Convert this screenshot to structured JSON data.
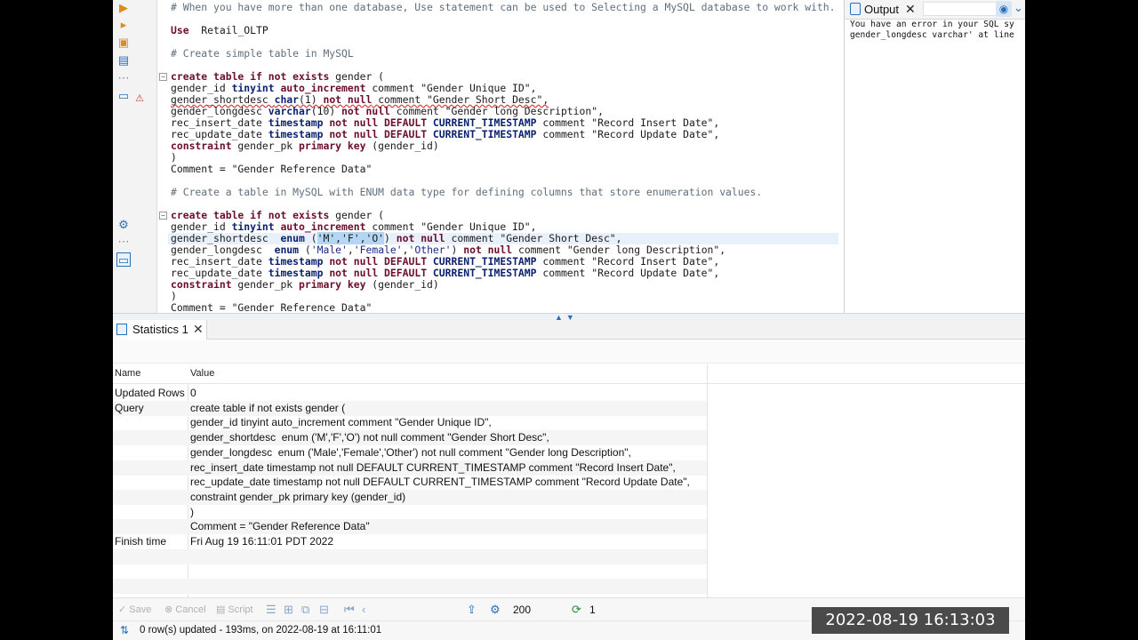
{
  "editor": {
    "lines": [
      {
        "id": "l0",
        "type": "comment",
        "text": "# When you have more than one database, Use statement can be used to Selecting a MySQL database to work with."
      },
      {
        "id": "l1",
        "type": "code",
        "parts": [
          [
            "kw",
            "Use"
          ],
          [
            "",
            "  Retail_OLTP"
          ]
        ]
      },
      {
        "id": "l2",
        "type": "comment",
        "text": "# Create simple table in MySQL"
      },
      {
        "id": "l3",
        "type": "code",
        "parts": [
          [
            "kw",
            "create table if not exists"
          ],
          [
            "",
            " gender ("
          ]
        ]
      },
      {
        "id": "l4",
        "type": "code",
        "parts": [
          [
            "",
            "gender_id "
          ],
          [
            "kw2",
            "tinyint"
          ],
          [
            "",
            " "
          ],
          [
            "kw",
            "auto_increment"
          ],
          [
            "",
            " comment \"Gender Unique ID\","
          ]
        ]
      },
      {
        "id": "l5",
        "type": "code",
        "err": true,
        "parts": [
          [
            "",
            "gender_shortdesc "
          ],
          [
            "kw2",
            "char"
          ],
          [
            "",
            "(1) "
          ],
          [
            "kw",
            "not null"
          ],
          [
            "",
            " comment \"Gender Short Desc\","
          ]
        ]
      },
      {
        "id": "l6",
        "type": "code",
        "parts": [
          [
            "",
            "gender_longdesc "
          ],
          [
            "kw2",
            "varchar"
          ],
          [
            "",
            "(10) "
          ],
          [
            "kw",
            "not null"
          ],
          [
            "",
            " comment \"Gender long Description\","
          ]
        ]
      },
      {
        "id": "l7",
        "type": "code",
        "parts": [
          [
            "",
            "rec_insert_date "
          ],
          [
            "kw2",
            "timestamp"
          ],
          [
            "",
            " "
          ],
          [
            "kw",
            "not null DEFAULT"
          ],
          [
            "",
            " "
          ],
          [
            "kw2",
            "CURRENT_TIMESTAMP"
          ],
          [
            "",
            " comment \"Record Insert Date\","
          ]
        ]
      },
      {
        "id": "l8",
        "type": "code",
        "parts": [
          [
            "",
            "rec_update_date "
          ],
          [
            "kw2",
            "timestamp"
          ],
          [
            "",
            " "
          ],
          [
            "kw",
            "not null DEFAULT"
          ],
          [
            "",
            " "
          ],
          [
            "kw2",
            "CURRENT_TIMESTAMP"
          ],
          [
            "",
            " comment \"Record Update Date\","
          ]
        ]
      },
      {
        "id": "l9",
        "type": "code",
        "parts": [
          [
            "kw",
            "constraint"
          ],
          [
            "",
            " gender_pk "
          ],
          [
            "kw",
            "primary key"
          ],
          [
            "",
            " (gender_id)"
          ]
        ]
      },
      {
        "id": "l10",
        "type": "code",
        "parts": [
          [
            "",
            ")"
          ]
        ]
      },
      {
        "id": "l11",
        "type": "code",
        "parts": [
          [
            "",
            "Comment = \"Gender Reference Data\""
          ]
        ]
      },
      {
        "id": "l12",
        "type": "comment",
        "text": "# Create a table in MySQL with ENUM data type for defining columns that store enumeration values."
      },
      {
        "id": "l13",
        "type": "code",
        "parts": [
          [
            "kw",
            "create table if not exists"
          ],
          [
            "",
            " gender ("
          ]
        ]
      },
      {
        "id": "l14",
        "type": "code",
        "parts": [
          [
            "",
            "gender_id "
          ],
          [
            "kw2",
            "tinyint"
          ],
          [
            "",
            " "
          ],
          [
            "kw",
            "auto_increment"
          ],
          [
            "",
            " comment \"Gender Unique ID\","
          ]
        ]
      },
      {
        "id": "l15",
        "type": "code",
        "hl": true,
        "parts": [
          [
            "",
            "gender_shortdesc  "
          ],
          [
            "kw2",
            "enum"
          ],
          [
            "",
            " ("
          ],
          [
            "sel",
            "'M','F','O'"
          ],
          [
            "",
            ") "
          ],
          [
            "kw",
            "not null"
          ],
          [
            "",
            " comment \"Gender Short Desc\","
          ]
        ]
      },
      {
        "id": "l16",
        "type": "code",
        "parts": [
          [
            "",
            "gender_longdesc  "
          ],
          [
            "kw2",
            "enum"
          ],
          [
            "",
            " ("
          ],
          [
            "str",
            "'Male'"
          ],
          [
            "",
            ","
          ],
          [
            "str",
            "'Female'"
          ],
          [
            "",
            ","
          ],
          [
            "str",
            "'Other'"
          ],
          [
            "",
            ") "
          ],
          [
            "kw",
            "not null"
          ],
          [
            "",
            " comment \"Gender long Description\","
          ]
        ]
      },
      {
        "id": "l17",
        "type": "code",
        "parts": [
          [
            "",
            "rec_insert_date "
          ],
          [
            "kw2",
            "timestamp"
          ],
          [
            "",
            " "
          ],
          [
            "kw",
            "not null DEFAULT"
          ],
          [
            "",
            " "
          ],
          [
            "kw2",
            "CURRENT_TIMESTAMP"
          ],
          [
            "",
            " comment \"Record Insert Date\","
          ]
        ]
      },
      {
        "id": "l18",
        "type": "code",
        "parts": [
          [
            "",
            "rec_update_date "
          ],
          [
            "kw2",
            "timestamp"
          ],
          [
            "",
            " "
          ],
          [
            "kw",
            "not null DEFAULT"
          ],
          [
            "",
            " "
          ],
          [
            "kw2",
            "CURRENT_TIMESTAMP"
          ],
          [
            "",
            " comment \"Record Update Date\","
          ]
        ]
      },
      {
        "id": "l19",
        "type": "code",
        "parts": [
          [
            "kw",
            "constraint"
          ],
          [
            "",
            " gender_pk "
          ],
          [
            "kw",
            "primary key"
          ],
          [
            "",
            " (gender_id)"
          ]
        ]
      },
      {
        "id": "l20",
        "type": "code",
        "parts": [
          [
            "",
            ")"
          ]
        ]
      },
      {
        "id": "l21",
        "type": "code",
        "parts": [
          [
            "",
            "Comment = \"Gender Reference Data\""
          ]
        ]
      }
    ]
  },
  "output_panel": {
    "tab_label": "Output",
    "lines": [
      "You have an error in your SQL sy",
      "gender_longdesc varchar' at line"
    ]
  },
  "results": {
    "tab_label": "Statistics 1",
    "columns": {
      "name": "Name",
      "value": "Value"
    },
    "rows": [
      {
        "name": "Updated Rows",
        "value": "0"
      },
      {
        "name": "Query",
        "value": "create table if not exists gender ("
      },
      {
        "name": "",
        "value": "gender_id tinyint auto_increment comment \"Gender Unique ID\","
      },
      {
        "name": "",
        "value": "gender_shortdesc  enum ('M','F','O') not null comment \"Gender Short Desc\","
      },
      {
        "name": "",
        "value": "gender_longdesc  enum ('Male','Female','Other') not null comment \"Gender long Description\","
      },
      {
        "name": "",
        "value": "rec_insert_date timestamp not null DEFAULT CURRENT_TIMESTAMP comment \"Record Insert Date\","
      },
      {
        "name": "",
        "value": "rec_update_date timestamp not null DEFAULT CURRENT_TIMESTAMP comment \"Record Update Date\","
      },
      {
        "name": "",
        "value": "constraint gender_pk primary key (gender_id)"
      },
      {
        "name": "",
        "value": ")"
      },
      {
        "name": "",
        "value": "Comment = \"Gender Reference Data\""
      },
      {
        "name": "Finish time",
        "value": "Fri Aug 19 16:11:01 PDT 2022"
      }
    ]
  },
  "bottom_toolbar": {
    "save_label": "Save",
    "cancel_label": "Cancel",
    "script_label": "Script",
    "fetch_size": "200",
    "refresh_count": "1"
  },
  "status": {
    "text": "0 row(s) updated - 193ms, on 2022-08-19 at 16:11:01"
  },
  "overlay": {
    "timestamp": "2022-08-19 16:13:03"
  },
  "colors": {
    "keyword": "#6b0d2b",
    "type_keyword": "#0a1f6e",
    "accent": "#2a6ebb",
    "error": "#d23c3c"
  }
}
